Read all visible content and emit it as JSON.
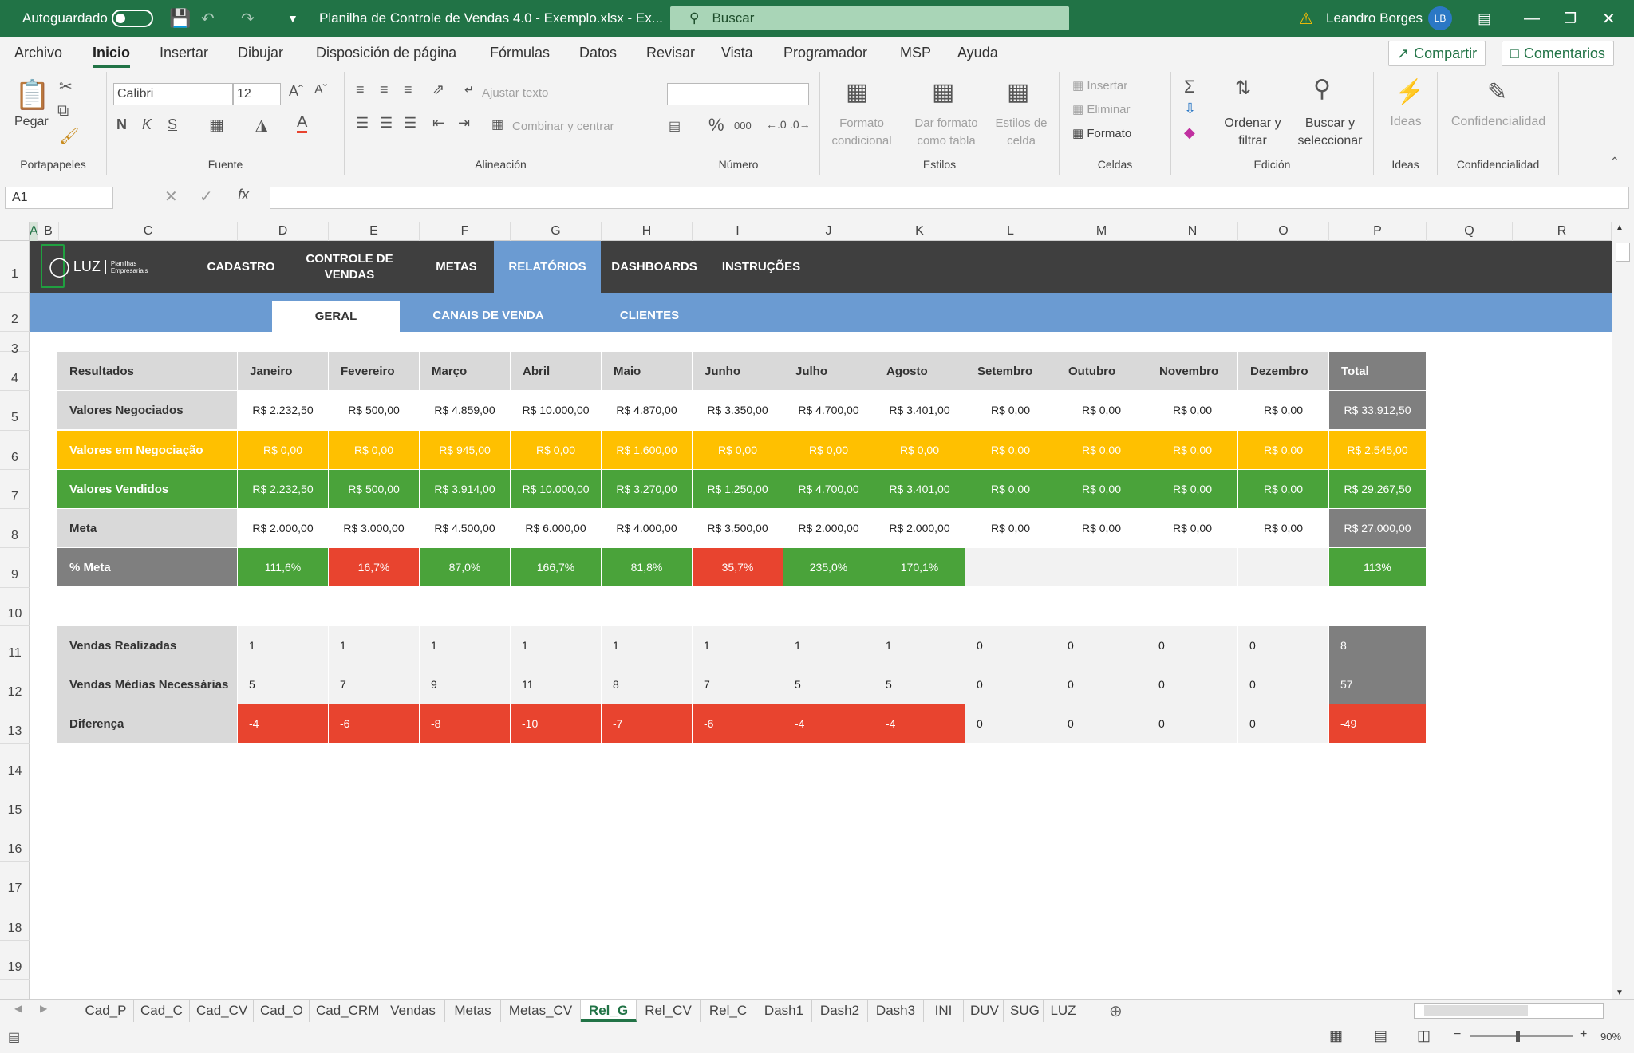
{
  "titlebar": {
    "autosave": "Autoguardado",
    "doc_title": "Planilha de Controle de Vendas 4.0 - Exemplo.xlsx  -  Ex...",
    "search": "Buscar",
    "user": "Leandro Borges",
    "user_initials": "LB"
  },
  "menu": {
    "tabs": [
      "Archivo",
      "Inicio",
      "Insertar",
      "Dibujar",
      "Disposición de página",
      "Fórmulas",
      "Datos",
      "Revisar",
      "Vista",
      "Programador",
      "MSP",
      "Ayuda"
    ],
    "share": "Compartir",
    "comments": "Comentarios"
  },
  "ribbon": {
    "clipboard": {
      "paste": "Pegar",
      "label": "Portapapeles"
    },
    "font": {
      "family": "Calibri",
      "size": "12",
      "label": "Fuente",
      "bold": "N",
      "italic": "K",
      "underline": "S"
    },
    "alignment": {
      "wrap": "Ajustar texto",
      "merge": "Combinar y centrar",
      "label": "Alineación"
    },
    "number": {
      "label": "Número",
      "percent": "%",
      "thousands": "000"
    },
    "styles": {
      "cond1": "Formato",
      "cond2": "condicional",
      "table1": "Dar formato",
      "table2": "como tabla",
      "cell1": "Estilos de",
      "cell2": "celda",
      "label": "Estilos"
    },
    "cells": {
      "insert": "Insertar",
      "delete": "Eliminar",
      "format": "Formato",
      "label": "Celdas"
    },
    "editing": {
      "sort1": "Ordenar y",
      "sort2": "filtrar",
      "find1": "Buscar y",
      "find2": "seleccionar",
      "label": "Edición"
    },
    "ideas": {
      "btn": "Ideas",
      "label": "Ideas"
    },
    "confidentiality": {
      "btn": "Confidencialidad",
      "label": "Confidencialidad"
    }
  },
  "formula": {
    "namebox": "A1",
    "fx": "fx"
  },
  "columns": [
    "A",
    "B",
    "C",
    "D",
    "E",
    "F",
    "G",
    "H",
    "I",
    "J",
    "K",
    "L",
    "M",
    "N",
    "O",
    "P",
    "Q",
    "R"
  ],
  "rows": [
    "1",
    "2",
    "3",
    "4",
    "5",
    "6",
    "7",
    "8",
    "9",
    "10",
    "11",
    "12",
    "13",
    "14",
    "15",
    "16",
    "17",
    "18",
    "19"
  ],
  "logo": {
    "brand": "LUZ",
    "tag1": "Planilhas",
    "tag2": "Empresariais"
  },
  "nav": [
    "CADASTRO",
    "CONTROLE DE VENDAS",
    "METAS",
    "RELATÓRIOS",
    "DASHBOARDS",
    "INSTRUÇÕES"
  ],
  "subnav": [
    "GERAL",
    "CANAIS DE VENDA",
    "CLIENTES"
  ],
  "table1": {
    "headers": [
      "Resultados",
      "Janeiro",
      "Fevereiro",
      "Março",
      "Abril",
      "Maio",
      "Junho",
      "Julho",
      "Agosto",
      "Setembro",
      "Outubro",
      "Novembro",
      "Dezembro",
      "Total"
    ],
    "rows": [
      {
        "label": "Valores Negociados",
        "values": [
          "R$ 2.232,50",
          "R$ 500,00",
          "R$ 4.859,00",
          "R$ 10.000,00",
          "R$ 4.870,00",
          "R$ 3.350,00",
          "R$ 4.700,00",
          "R$ 3.401,00",
          "R$ 0,00",
          "R$ 0,00",
          "R$ 0,00",
          "R$ 0,00"
        ],
        "total": "R$ 33.912,50"
      },
      {
        "label": "Valores em Negociação",
        "values": [
          "R$ 0,00",
          "R$ 0,00",
          "R$ 945,00",
          "R$ 0,00",
          "R$ 1.600,00",
          "R$ 0,00",
          "R$ 0,00",
          "R$ 0,00",
          "R$ 0,00",
          "R$ 0,00",
          "R$ 0,00",
          "R$ 0,00"
        ],
        "total": "R$ 2.545,00"
      },
      {
        "label": "Valores Vendidos",
        "values": [
          "R$ 2.232,50",
          "R$ 500,00",
          "R$ 3.914,00",
          "R$ 10.000,00",
          "R$ 3.270,00",
          "R$ 1.250,00",
          "R$ 4.700,00",
          "R$ 3.401,00",
          "R$ 0,00",
          "R$ 0,00",
          "R$ 0,00",
          "R$ 0,00"
        ],
        "total": "R$ 29.267,50"
      },
      {
        "label": "Meta",
        "values": [
          "R$ 2.000,00",
          "R$ 3.000,00",
          "R$ 4.500,00",
          "R$ 6.000,00",
          "R$ 4.000,00",
          "R$ 3.500,00",
          "R$ 2.000,00",
          "R$ 2.000,00",
          "R$ 0,00",
          "R$ 0,00",
          "R$ 0,00",
          "R$ 0,00"
        ],
        "total": "R$ 27.000,00"
      },
      {
        "label": "% Meta",
        "values": [
          "111,6%",
          "16,7%",
          "87,0%",
          "166,7%",
          "81,8%",
          "35,7%",
          "235,0%",
          "170,1%",
          "",
          "",
          "",
          ""
        ],
        "total": "113%"
      }
    ]
  },
  "table2": {
    "rows": [
      {
        "label": "Vendas Realizadas",
        "values": [
          "1",
          "1",
          "1",
          "1",
          "1",
          "1",
          "1",
          "1",
          "0",
          "0",
          "0",
          "0"
        ],
        "total": "8"
      },
      {
        "label": "Vendas Médias Necessárias",
        "values": [
          "5",
          "7",
          "9",
          "11",
          "8",
          "7",
          "5",
          "5",
          "0",
          "0",
          "0",
          "0"
        ],
        "total": "57"
      },
      {
        "label": "Diferença",
        "values": [
          "-4",
          "-6",
          "-8",
          "-10",
          "-7",
          "-6",
          "-4",
          "-4",
          "0",
          "0",
          "0",
          "0"
        ],
        "total": "-49"
      }
    ]
  },
  "colors": {
    "green": "#4aa33a",
    "red": "#e8442f",
    "yellow": "#ffc000",
    "grey_dark": "#7f7f7f",
    "grey_label": "#d9d9d9",
    "nav_dark": "#3f3f3f",
    "nav_blue": "#6b9bd2",
    "excel_green": "#217346"
  },
  "sheets": [
    "Cad_P",
    "Cad_C",
    "Cad_CV",
    "Cad_O",
    "Cad_CRM",
    "Vendas",
    "Metas",
    "Metas_CV",
    "Rel_G",
    "Rel_CV",
    "Rel_C",
    "Dash1",
    "Dash2",
    "Dash3",
    "INI",
    "DUV",
    "SUG",
    "LUZ"
  ],
  "active_sheet": "Rel_G",
  "status": {
    "zoom": "90%"
  }
}
